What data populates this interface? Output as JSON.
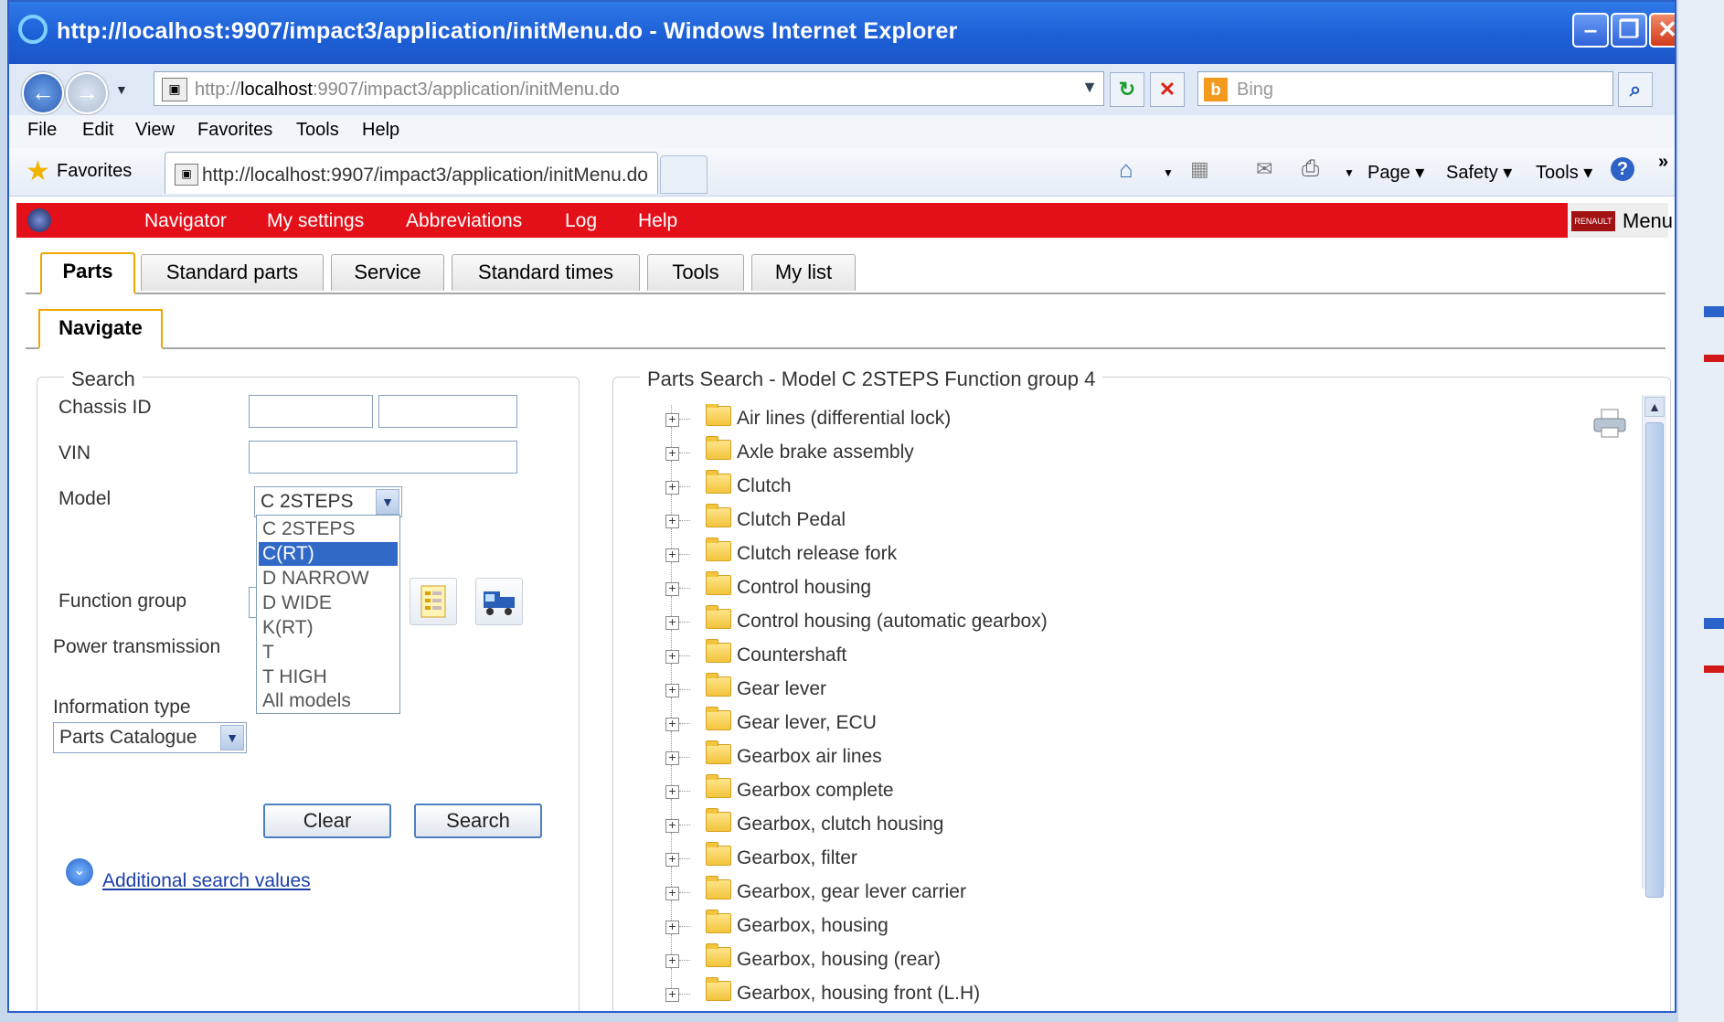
{
  "window": {
    "title": "http://localhost:9907/impact3/application/initMenu.do - Windows Internet Explorer",
    "address_prefix": "http://",
    "address_host": "localhost",
    "address_rest": ":9907/impact3/application/initMenu.do",
    "search_placeholder": "Bing",
    "menu": [
      "File",
      "Edit",
      "View",
      "Favorites",
      "Tools",
      "Help"
    ],
    "favorites_label": "Favorites",
    "tab_title": "http://localhost:9907/impact3/application/initMenu.do",
    "commands": [
      "Page ▾",
      "Safety ▾",
      "Tools ▾"
    ]
  },
  "app": {
    "nav": [
      "Navigator",
      "My settings",
      "Abbreviations",
      "Log",
      "Help"
    ],
    "menu_label": "Menu",
    "brand": "RENAULT TRUCKS",
    "tabs": [
      "Parts",
      "Standard parts",
      "Service",
      "Standard times",
      "Tools",
      "My list"
    ],
    "subtab": "Navigate"
  },
  "search": {
    "legend": "Search",
    "chassis_label": "Chassis ID",
    "vin_label": "VIN",
    "model_label": "Model",
    "model_value": "C 2STEPS",
    "model_options": [
      "C 2STEPS",
      "C(RT)",
      "D NARROW",
      "D WIDE",
      "K(RT)",
      "T",
      "T HIGH",
      "All models"
    ],
    "model_highlighted": "C(RT)",
    "function_group_label": "Function group",
    "power_transmission_label": "Power transmission",
    "info_type_label": "Information type",
    "info_type_value": "Parts Catalogue",
    "clear_label": "Clear",
    "search_label": "Search",
    "additional_label": "Additional search values"
  },
  "results": {
    "legend": "Parts Search - Model C 2STEPS Function group 4",
    "items": [
      "Air lines (differential lock)",
      "Axle brake assembly",
      "Clutch",
      "Clutch Pedal",
      "Clutch release fork",
      "Control housing",
      "Control housing (automatic gearbox)",
      "Countershaft",
      "Gear lever",
      "Gear lever, ECU",
      "Gearbox air lines",
      "Gearbox complete",
      "Gearbox, clutch housing",
      "Gearbox, filter",
      "Gearbox, gear lever carrier",
      "Gearbox, housing",
      "Gearbox, housing (rear)",
      "Gearbox, housing front (L.H)"
    ]
  },
  "colors": {
    "titlebar": "#1d5fd6",
    "app_bar": "#e3101a",
    "tab_accent": "#f0a500",
    "link": "#1b3fa8"
  }
}
